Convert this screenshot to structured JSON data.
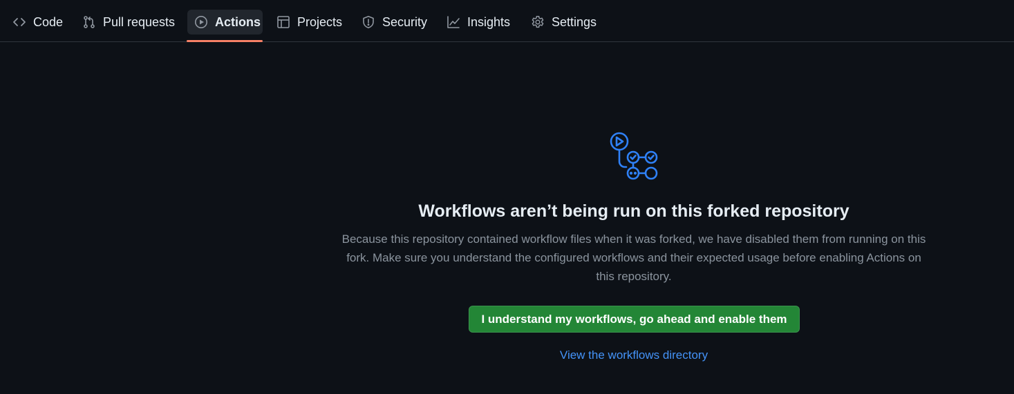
{
  "tabs": [
    {
      "label": "Code",
      "icon": "code-icon"
    },
    {
      "label": "Pull requests",
      "icon": "pull-request-icon"
    },
    {
      "label": "Actions",
      "icon": "play-icon",
      "active": true
    },
    {
      "label": "Projects",
      "icon": "table-icon"
    },
    {
      "label": "Security",
      "icon": "shield-icon"
    },
    {
      "label": "Insights",
      "icon": "graph-icon"
    },
    {
      "label": "Settings",
      "icon": "gear-icon"
    }
  ],
  "main": {
    "hero_icon": "workflow-icon",
    "title": "Workflows aren’t being run on this forked repository",
    "description": "Because this repository contained workflow files when it was forked, we have disabled them from running on this fork. Make sure you understand the configured workflows and their expected usage before enabling Actions on this repository.",
    "enable_button": "I understand my workflows, go ahead and enable them",
    "directory_link": "View the workflows directory"
  },
  "colors": {
    "background": "#0d1117",
    "active_tab_underline": "#f78166",
    "primary_button": "#238636",
    "link": "#4493f8",
    "icon_accent": "#2f81f7"
  }
}
